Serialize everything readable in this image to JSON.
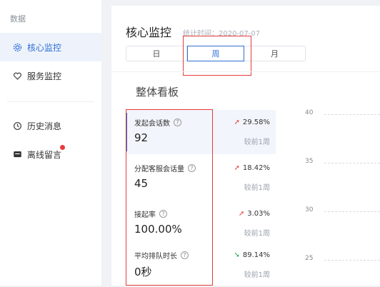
{
  "sidebar": {
    "section": "数据",
    "items": [
      {
        "label": "核心监控",
        "icon": "gear-icon",
        "active": true
      },
      {
        "label": "服务监控",
        "icon": "heart-icon",
        "active": false
      },
      {
        "label": "历史消息",
        "icon": "clock-icon",
        "active": false
      },
      {
        "label": "离线留言",
        "icon": "message-icon",
        "active": false,
        "badge": true
      }
    ]
  },
  "header": {
    "title": "核心监控",
    "stat_time": "统计时间：2020-07-07",
    "tabs": [
      "日",
      "周",
      "月"
    ],
    "selected_tab": "周"
  },
  "board": {
    "title": "整体看板",
    "kpis": [
      {
        "label": "发起会话数",
        "value": "92",
        "change": "29.58%",
        "direction": "up",
        "compare": "较前1周"
      },
      {
        "label": "分配客服会话量",
        "value": "45",
        "change": "18.42%",
        "direction": "up",
        "compare": "较前1周"
      },
      {
        "label": "接起率",
        "value": "100.00%",
        "change": "3.03%",
        "direction": "up",
        "compare": "较前1周"
      },
      {
        "label": "平均排队时长",
        "value": "0秒",
        "change": "89.14%",
        "direction": "down",
        "compare": "较前1周"
      }
    ]
  },
  "chart_data": {
    "type": "line",
    "yticks": [
      40,
      35,
      30,
      25
    ],
    "series": []
  },
  "colors": {
    "accent": "#2f6fd6",
    "highlight_red": "#e63b3b",
    "up": "#e63b3b",
    "down": "#1fa35a"
  }
}
